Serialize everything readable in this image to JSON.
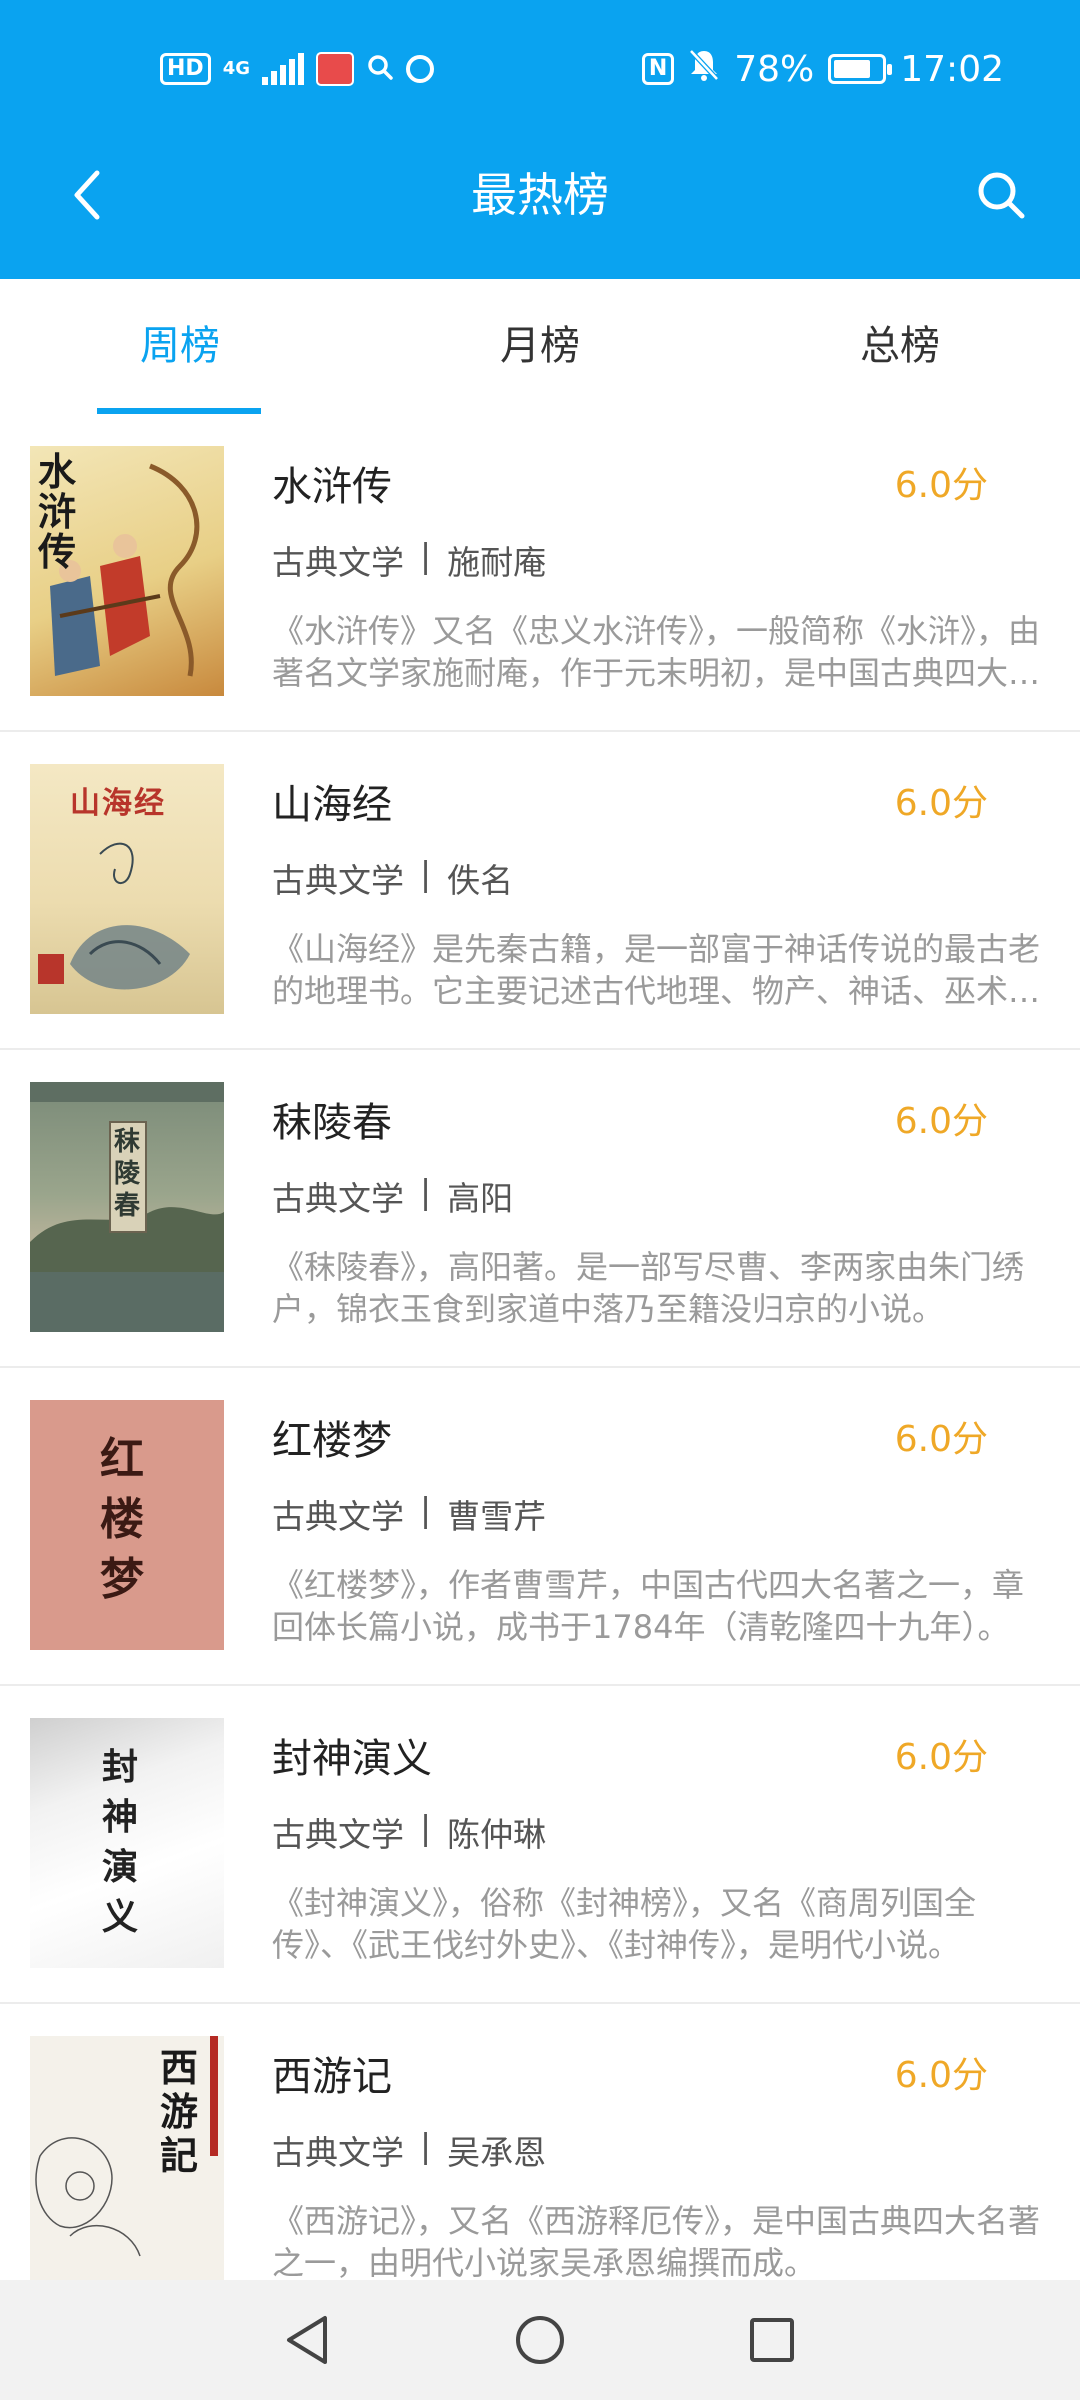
{
  "status_bar": {
    "hd_badge": "HD",
    "network": "4G",
    "nfc_label": "N",
    "battery_percent": "78%",
    "time": "17:02"
  },
  "header": {
    "title": "最热榜",
    "back_icon": "back-chevron-icon",
    "search_icon": "search-icon",
    "background_color": "#0aa3f0"
  },
  "tabs": [
    {
      "label": "周榜",
      "active": true
    },
    {
      "label": "月榜",
      "active": false
    },
    {
      "label": "总榜",
      "active": false
    }
  ],
  "accent_color": "#0aa3f0",
  "score_color": "#efa827",
  "books": [
    {
      "title": "水浒传",
      "score": "6.0分",
      "category": "古典文学",
      "separator": "|",
      "author": "施耐庵",
      "description": "《水浒传》又名《忠义水浒传》，一般简称《水浒》，由著名文学家施耐庵，作于元末明初，是中国古典四大名著之一。",
      "cover_text": "水浒传"
    },
    {
      "title": "山海经",
      "score": "6.0分",
      "category": "古典文学",
      "separator": "|",
      "author": "佚名",
      "description": "《山海经》是先秦古籍，是一部富于神话传说的最古老的地理书。它主要记述古代地理、物产、神话、巫术、宗教等。",
      "cover_text": "山海经"
    },
    {
      "title": "秣陵春",
      "score": "6.0分",
      "category": "古典文学",
      "separator": "|",
      "author": "高阳",
      "description": "《秣陵春》，高阳著。是一部写尽曹、李两家由朱门绣户，锦衣玉食到家道中落乃至籍没归京的小说。",
      "cover_text": "秣陵春"
    },
    {
      "title": "红楼梦",
      "score": "6.0分",
      "category": "古典文学",
      "separator": "|",
      "author": "曹雪芹",
      "description": "《红楼梦》，作者曹雪芹，中国古代四大名著之一，章回体长篇小说，成书于1784年（清乾隆四十九年）。",
      "cover_text": "红楼梦"
    },
    {
      "title": "封神演义",
      "score": "6.0分",
      "category": "古典文学",
      "separator": "|",
      "author": "陈仲琳",
      "description": "《封神演义》，俗称《封神榜》，又名《商周列国全传》、《武王伐纣外史》、《封神传》，是明代小说。",
      "cover_text": "封神演义"
    },
    {
      "title": "西游记",
      "score": "6.0分",
      "category": "古典文学",
      "separator": "|",
      "author": "吴承恩",
      "description": "《西游记》，又名《西游释厄传》，是中国古典四大名著之一，由明代小说家吴承恩编撰而成。",
      "cover_text": "西游記"
    }
  ],
  "nav_bar": {
    "back_icon": "nav-back-triangle-icon",
    "home_icon": "nav-home-circle-icon",
    "recents_icon": "nav-recents-square-icon"
  }
}
